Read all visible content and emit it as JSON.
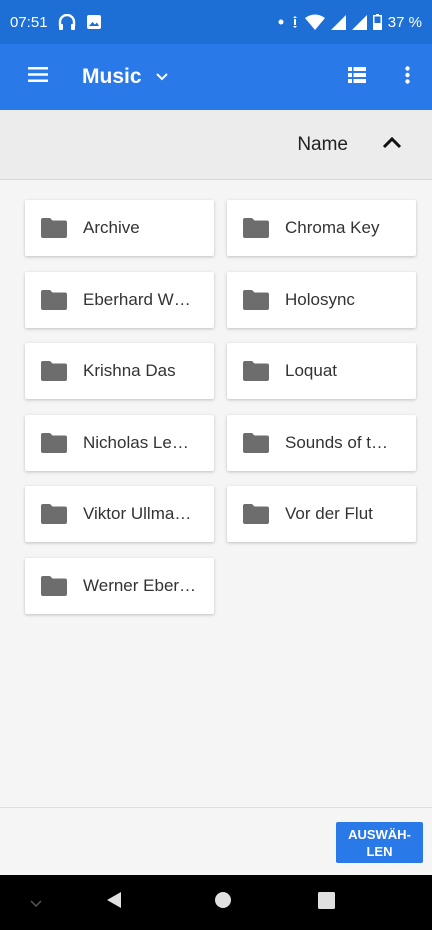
{
  "status_bar": {
    "time": "07:51",
    "battery": "37 %",
    "icons": [
      "headphones-icon",
      "image-icon",
      "dot-icon",
      "vibrate-icon",
      "wifi-icon",
      "signal-icon",
      "signal-icon",
      "battery-icon"
    ]
  },
  "app_bar": {
    "title": "Music",
    "icons": [
      "menu-icon",
      "chevron-down-icon",
      "list-view-icon",
      "more-vert-icon"
    ],
    "color": "#2979e8"
  },
  "sort": {
    "label": "Name",
    "direction_icon": "chevron-up-icon"
  },
  "folders": [
    "Archive",
    "Chroma Key",
    "Eberhard W…",
    "Holosync",
    "Krishna Das",
    "Loquat",
    "Nicholas Le…",
    "Sounds of t…",
    "Viktor Ullma…",
    "Vor der Flut",
    "Werner Eber…"
  ],
  "footer": {
    "select_button": "AUSWÄH-\nLEN"
  },
  "nav_bar": {
    "icons": [
      "chevron-down-icon",
      "back-icon",
      "home-icon",
      "recents-icon"
    ]
  }
}
